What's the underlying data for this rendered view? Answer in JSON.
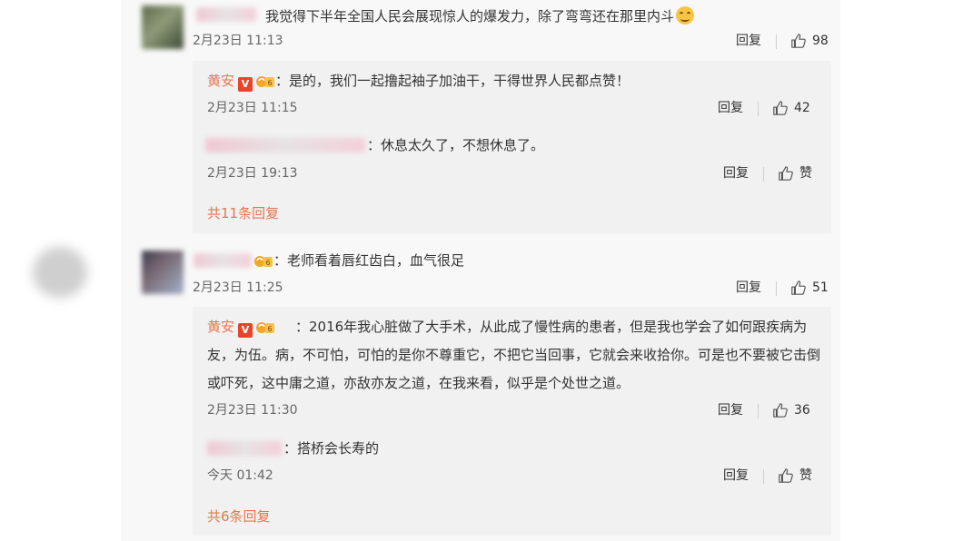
{
  "comments": [
    {
      "text": "我觉得下半年全国人民会展现惊人的爆发力，除了弯弯还在那里内斗",
      "time": "2月23日 11:13",
      "reply_label": "回复",
      "likes": "98",
      "replies": [
        {
          "author": "黄安",
          "text": "：是的，我们一起撸起袖子加油干，干得世界人民都点赞！",
          "time": "2月23日 11:15",
          "reply_label": "回复",
          "likes": "42"
        },
        {
          "text": "：休息太久了，不想休息了。",
          "time": "2月23日 19:13",
          "reply_label": "回复",
          "likes": "赞"
        }
      ],
      "more_replies": "共11条回复"
    },
    {
      "text": "：老师看着唇红齿白，血气很足",
      "time": "2月23日 11:25",
      "reply_label": "回复",
      "likes": "51",
      "replies": [
        {
          "author": "黄安",
          "text": "：2016年我心脏做了大手术，从此成了慢性病的患者，但是我也学会了如何跟疾病为友，为伍。病，不可怕，可怕的是你不尊重它，不把它当回事，它就会来收拾你。可是也不要被它击倒或吓死，这中庸之道，亦敌亦友之道，在我来看，似乎是个处世之道。",
          "time": "2月23日 11:30",
          "reply_label": "回复",
          "likes": "36"
        },
        {
          "text": "：搭桥会长寿的",
          "time": "今天 01:42",
          "reply_label": "回复",
          "likes": "赞"
        }
      ],
      "more_replies": "共6条回复"
    }
  ],
  "badges": {
    "verified_letter": "V"
  },
  "colors": {
    "accent": "#eb7350",
    "badge_red": "#e8442c",
    "panel_bg": "#f8f8f8",
    "reply_bg": "#f1f1f1"
  },
  "icons": [
    "thumbs-up-icon",
    "verified-badge-icon",
    "fan-badge-icon"
  ]
}
